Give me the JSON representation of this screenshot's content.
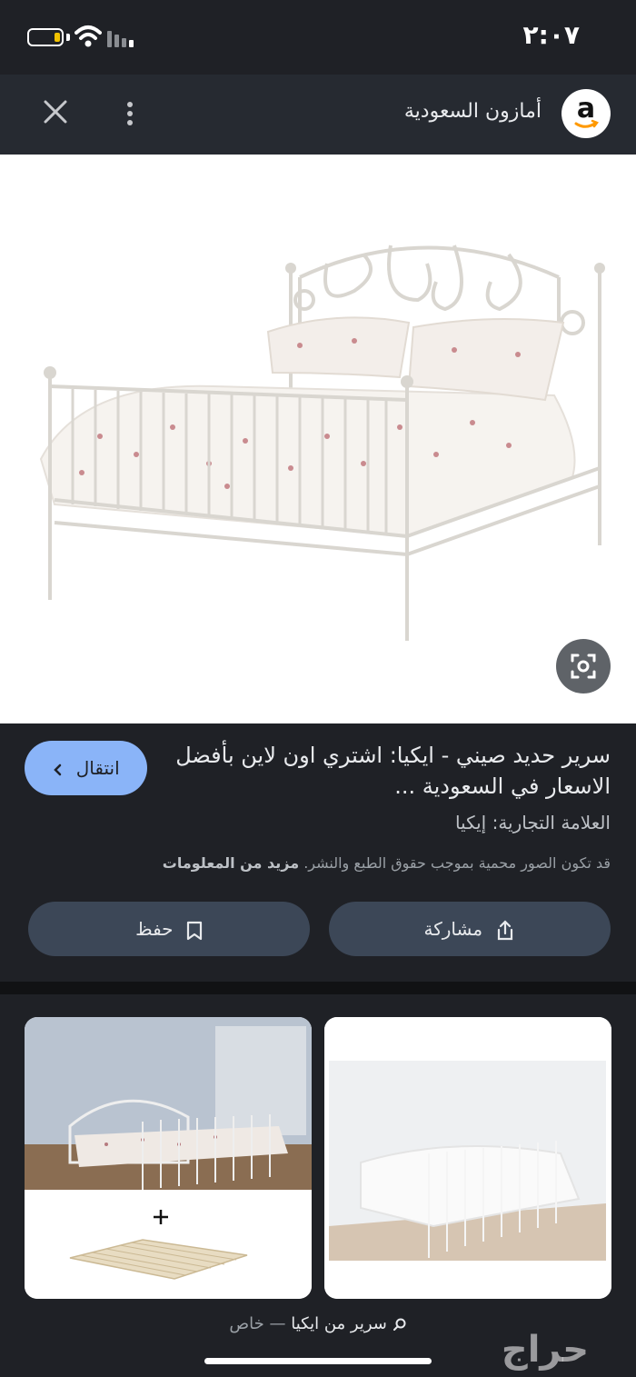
{
  "status_bar": {
    "time": "٢:٠٧"
  },
  "header": {
    "site_name": "أمازون السعودية",
    "logo_letter": "a"
  },
  "result": {
    "title": "سرير حديد صيني - ايكيا: اشتري اون لاين بأفضل الاسعار في السعودية ...",
    "visit_label": "انتقال",
    "brand": "العلامة التجارية: إيكيا",
    "copyright_text": "قد تكون الصور محمية بموجب حقوق الطبع والنشر.",
    "more_info": "مزيد من المعلومات",
    "share_label": "مشاركة",
    "save_label": "حفظ"
  },
  "bottom_bar": {
    "query": "سرير من ايكيا",
    "separator": "—",
    "mode": "خاص"
  },
  "watermark": "حراج",
  "colors": {
    "accent": "#8ab4f8",
    "background": "#1f2126",
    "button": "#3c4757"
  },
  "icons": [
    "close-icon",
    "more-vert-icon",
    "amazon-logo",
    "lens-icon",
    "chevron-left-icon",
    "share-icon",
    "bookmark-icon",
    "search-icon"
  ]
}
